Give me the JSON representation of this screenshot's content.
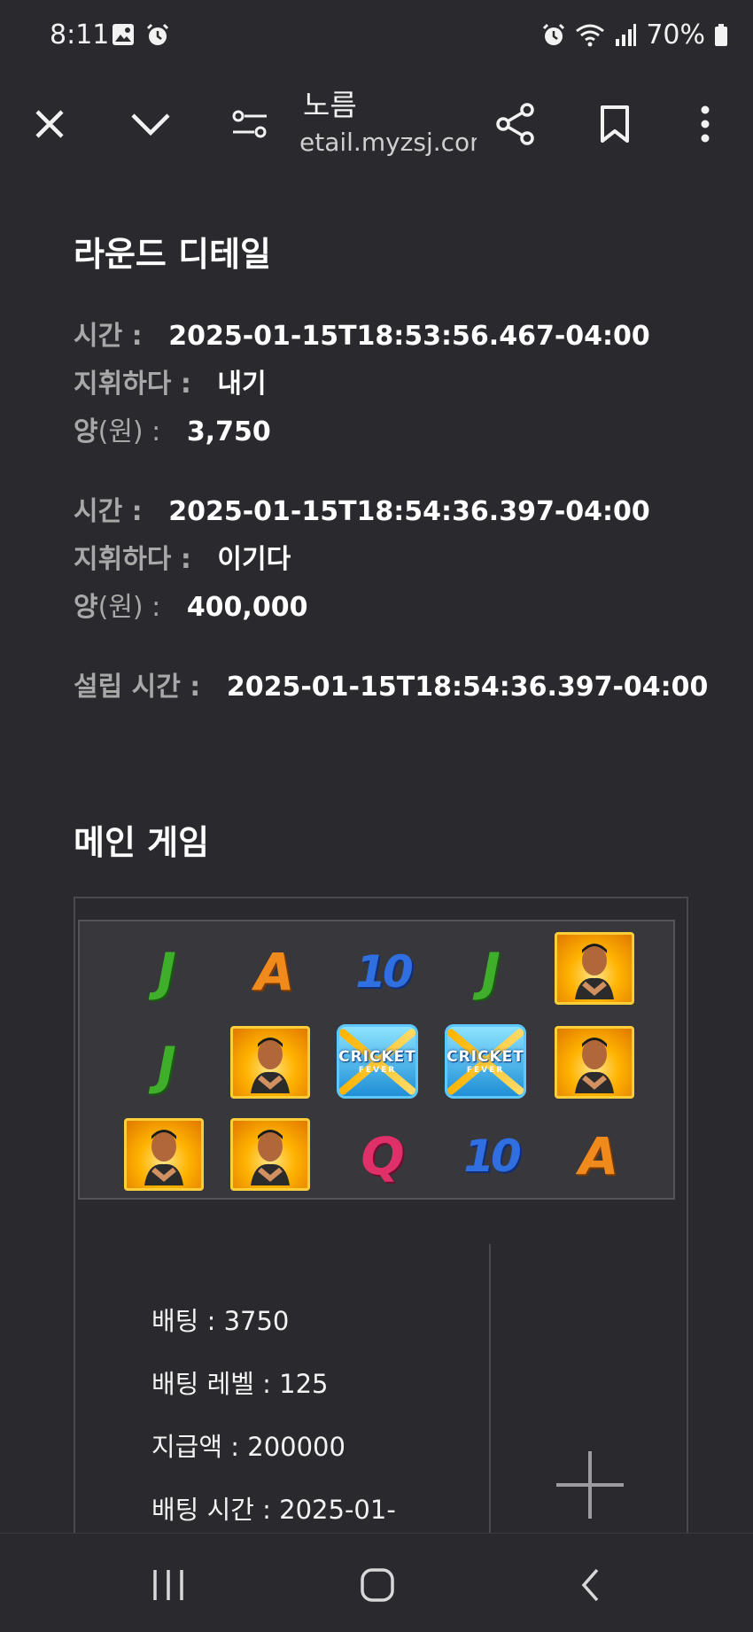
{
  "status_bar": {
    "time": "8:11",
    "battery": "70%",
    "icons": [
      "gallery-icon",
      "alarm-icon",
      "alarm-icon",
      "wifi-icon",
      "signal-icon",
      "battery-icon"
    ]
  },
  "browser": {
    "title": "노름",
    "url": "etail.myzsj.com"
  },
  "round_detail": {
    "heading": "라운드 디테일",
    "entries": [
      {
        "time_label": "시간 :",
        "time": "2025-01-15T18:53:56.467-04:00",
        "action_label": "지휘하다 :",
        "action": "내기",
        "amount_label_a": "양",
        "amount_label_b": "(원) :",
        "amount": "3,750"
      },
      {
        "time_label": "시간 :",
        "time": "2025-01-15T18:54:36.397-04:00",
        "action_label": "지휘하다 :",
        "action": "이기다",
        "amount_label_a": "양",
        "amount_label_b": "(원) :",
        "amount": "400,000"
      }
    ],
    "settle_label": "설립 시간 :",
    "settle_time": "2025-01-15T18:54:36.397-04:00"
  },
  "main_game": {
    "heading": "메인 게임",
    "reels": [
      [
        "J",
        "A",
        "10",
        "J",
        "portrait"
      ],
      [
        "J",
        "portrait",
        "cricket",
        "cricket",
        "portrait"
      ],
      [
        "portrait",
        "portrait",
        "Q",
        "10",
        "A"
      ]
    ],
    "cricket_label": "CRICKET",
    "cricket_sub": "FEVER",
    "info": {
      "bet": "배팅 : 3750",
      "bet_level": "배팅 레벨 : 125",
      "payout": "지급액 : 200000",
      "bet_time": "배팅 시간 : 2025-01-"
    }
  },
  "colors": {
    "background": "#2a292e",
    "label_gray": "#a8a8a8",
    "J": "#3fae2a",
    "A": "#f08a1c",
    "10": "#2f6fe0",
    "Q": "#e0306a"
  }
}
